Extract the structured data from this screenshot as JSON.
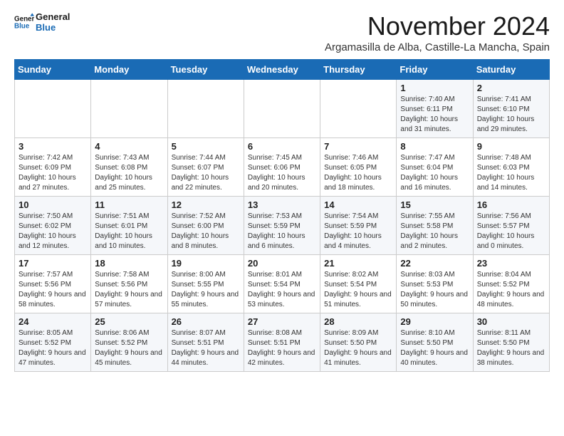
{
  "logo": {
    "line1": "General",
    "line2": "Blue"
  },
  "title": "November 2024",
  "location": "Argamasilla de Alba, Castille-La Mancha, Spain",
  "days_of_week": [
    "Sunday",
    "Monday",
    "Tuesday",
    "Wednesday",
    "Thursday",
    "Friday",
    "Saturday"
  ],
  "weeks": [
    [
      {
        "day": "",
        "info": ""
      },
      {
        "day": "",
        "info": ""
      },
      {
        "day": "",
        "info": ""
      },
      {
        "day": "",
        "info": ""
      },
      {
        "day": "",
        "info": ""
      },
      {
        "day": "1",
        "info": "Sunrise: 7:40 AM\nSunset: 6:11 PM\nDaylight: 10 hours and 31 minutes."
      },
      {
        "day": "2",
        "info": "Sunrise: 7:41 AM\nSunset: 6:10 PM\nDaylight: 10 hours and 29 minutes."
      }
    ],
    [
      {
        "day": "3",
        "info": "Sunrise: 7:42 AM\nSunset: 6:09 PM\nDaylight: 10 hours and 27 minutes."
      },
      {
        "day": "4",
        "info": "Sunrise: 7:43 AM\nSunset: 6:08 PM\nDaylight: 10 hours and 25 minutes."
      },
      {
        "day": "5",
        "info": "Sunrise: 7:44 AM\nSunset: 6:07 PM\nDaylight: 10 hours and 22 minutes."
      },
      {
        "day": "6",
        "info": "Sunrise: 7:45 AM\nSunset: 6:06 PM\nDaylight: 10 hours and 20 minutes."
      },
      {
        "day": "7",
        "info": "Sunrise: 7:46 AM\nSunset: 6:05 PM\nDaylight: 10 hours and 18 minutes."
      },
      {
        "day": "8",
        "info": "Sunrise: 7:47 AM\nSunset: 6:04 PM\nDaylight: 10 hours and 16 minutes."
      },
      {
        "day": "9",
        "info": "Sunrise: 7:48 AM\nSunset: 6:03 PM\nDaylight: 10 hours and 14 minutes."
      }
    ],
    [
      {
        "day": "10",
        "info": "Sunrise: 7:50 AM\nSunset: 6:02 PM\nDaylight: 10 hours and 12 minutes."
      },
      {
        "day": "11",
        "info": "Sunrise: 7:51 AM\nSunset: 6:01 PM\nDaylight: 10 hours and 10 minutes."
      },
      {
        "day": "12",
        "info": "Sunrise: 7:52 AM\nSunset: 6:00 PM\nDaylight: 10 hours and 8 minutes."
      },
      {
        "day": "13",
        "info": "Sunrise: 7:53 AM\nSunset: 5:59 PM\nDaylight: 10 hours and 6 minutes."
      },
      {
        "day": "14",
        "info": "Sunrise: 7:54 AM\nSunset: 5:59 PM\nDaylight: 10 hours and 4 minutes."
      },
      {
        "day": "15",
        "info": "Sunrise: 7:55 AM\nSunset: 5:58 PM\nDaylight: 10 hours and 2 minutes."
      },
      {
        "day": "16",
        "info": "Sunrise: 7:56 AM\nSunset: 5:57 PM\nDaylight: 10 hours and 0 minutes."
      }
    ],
    [
      {
        "day": "17",
        "info": "Sunrise: 7:57 AM\nSunset: 5:56 PM\nDaylight: 9 hours and 58 minutes."
      },
      {
        "day": "18",
        "info": "Sunrise: 7:58 AM\nSunset: 5:56 PM\nDaylight: 9 hours and 57 minutes."
      },
      {
        "day": "19",
        "info": "Sunrise: 8:00 AM\nSunset: 5:55 PM\nDaylight: 9 hours and 55 minutes."
      },
      {
        "day": "20",
        "info": "Sunrise: 8:01 AM\nSunset: 5:54 PM\nDaylight: 9 hours and 53 minutes."
      },
      {
        "day": "21",
        "info": "Sunrise: 8:02 AM\nSunset: 5:54 PM\nDaylight: 9 hours and 51 minutes."
      },
      {
        "day": "22",
        "info": "Sunrise: 8:03 AM\nSunset: 5:53 PM\nDaylight: 9 hours and 50 minutes."
      },
      {
        "day": "23",
        "info": "Sunrise: 8:04 AM\nSunset: 5:52 PM\nDaylight: 9 hours and 48 minutes."
      }
    ],
    [
      {
        "day": "24",
        "info": "Sunrise: 8:05 AM\nSunset: 5:52 PM\nDaylight: 9 hours and 47 minutes."
      },
      {
        "day": "25",
        "info": "Sunrise: 8:06 AM\nSunset: 5:52 PM\nDaylight: 9 hours and 45 minutes."
      },
      {
        "day": "26",
        "info": "Sunrise: 8:07 AM\nSunset: 5:51 PM\nDaylight: 9 hours and 44 minutes."
      },
      {
        "day": "27",
        "info": "Sunrise: 8:08 AM\nSunset: 5:51 PM\nDaylight: 9 hours and 42 minutes."
      },
      {
        "day": "28",
        "info": "Sunrise: 8:09 AM\nSunset: 5:50 PM\nDaylight: 9 hours and 41 minutes."
      },
      {
        "day": "29",
        "info": "Sunrise: 8:10 AM\nSunset: 5:50 PM\nDaylight: 9 hours and 40 minutes."
      },
      {
        "day": "30",
        "info": "Sunrise: 8:11 AM\nSunset: 5:50 PM\nDaylight: 9 hours and 38 minutes."
      }
    ]
  ]
}
